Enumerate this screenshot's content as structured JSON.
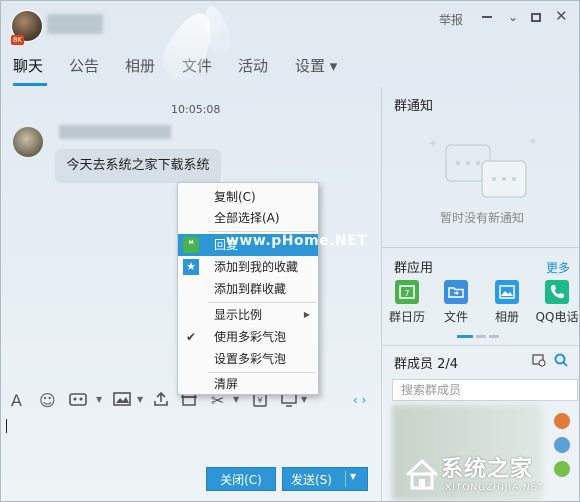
{
  "window": {
    "report_label": "举报",
    "avatar_badge": "8K",
    "chevron": "⌄",
    "close": "✕"
  },
  "tabs": [
    {
      "label": "聊天",
      "active": true
    },
    {
      "label": "公告"
    },
    {
      "label": "相册"
    },
    {
      "label": "文件"
    },
    {
      "label": "活动"
    },
    {
      "label": "设置 ▾"
    }
  ],
  "chat": {
    "timestamp": "10:05:08",
    "message": "今天去系统之家下载系统"
  },
  "context_menu": {
    "items": [
      {
        "label": "复制(C)",
        "icon": ""
      },
      {
        "label": "全部选择(A)",
        "icon": ""
      },
      {
        "label": "回复",
        "icon": "reply-icon",
        "highlighted": true
      },
      {
        "label": "添加到我的收藏",
        "icon": "star-icon"
      },
      {
        "label": "添加到群收藏",
        "icon": ""
      },
      {
        "label": "显示比例",
        "icon": "",
        "submenu": "▶"
      },
      {
        "label": "使用多彩气泡",
        "icon": "check-icon",
        "checked": true
      },
      {
        "label": "设置多彩气泡",
        "icon": ""
      },
      {
        "label": "清屏",
        "icon": ""
      }
    ],
    "check_glyph": "✔",
    "star_glyph": "★",
    "reply_glyph": "❝"
  },
  "toolbar": {
    "font_glyph": "A",
    "emoji_glyph": "☺",
    "nav_glyph": "‹ ›"
  },
  "buttons": {
    "close_label": "关闭(C)",
    "send_label": "发送(S)",
    "send_caret": "▼"
  },
  "sidebar": {
    "notice_title": "群通知",
    "notice_empty": "暂时没有新通知",
    "apps_title": "群应用",
    "more_label": "更多",
    "apps": [
      {
        "label": "群日历",
        "icon": "calendar-icon",
        "color": "#4caf50"
      },
      {
        "label": "文件",
        "icon": "folder-icon",
        "color": "#3d8ee0"
      },
      {
        "label": "相册",
        "icon": "photo-icon",
        "color": "#2c9be4"
      },
      {
        "label": "QQ电话",
        "icon": "phone-icon",
        "color": "#1db98a"
      }
    ],
    "members_title": "群成员 2/4",
    "search_placeholder": "搜索群成员"
  },
  "watermark": {
    "url_text": "www.pHome.NET",
    "brand": "系统之家",
    "brand_sub": "XITONGZHIJIA.NET"
  },
  "colors": {
    "accent": "#2d96d7",
    "link": "#1a8ee6"
  }
}
